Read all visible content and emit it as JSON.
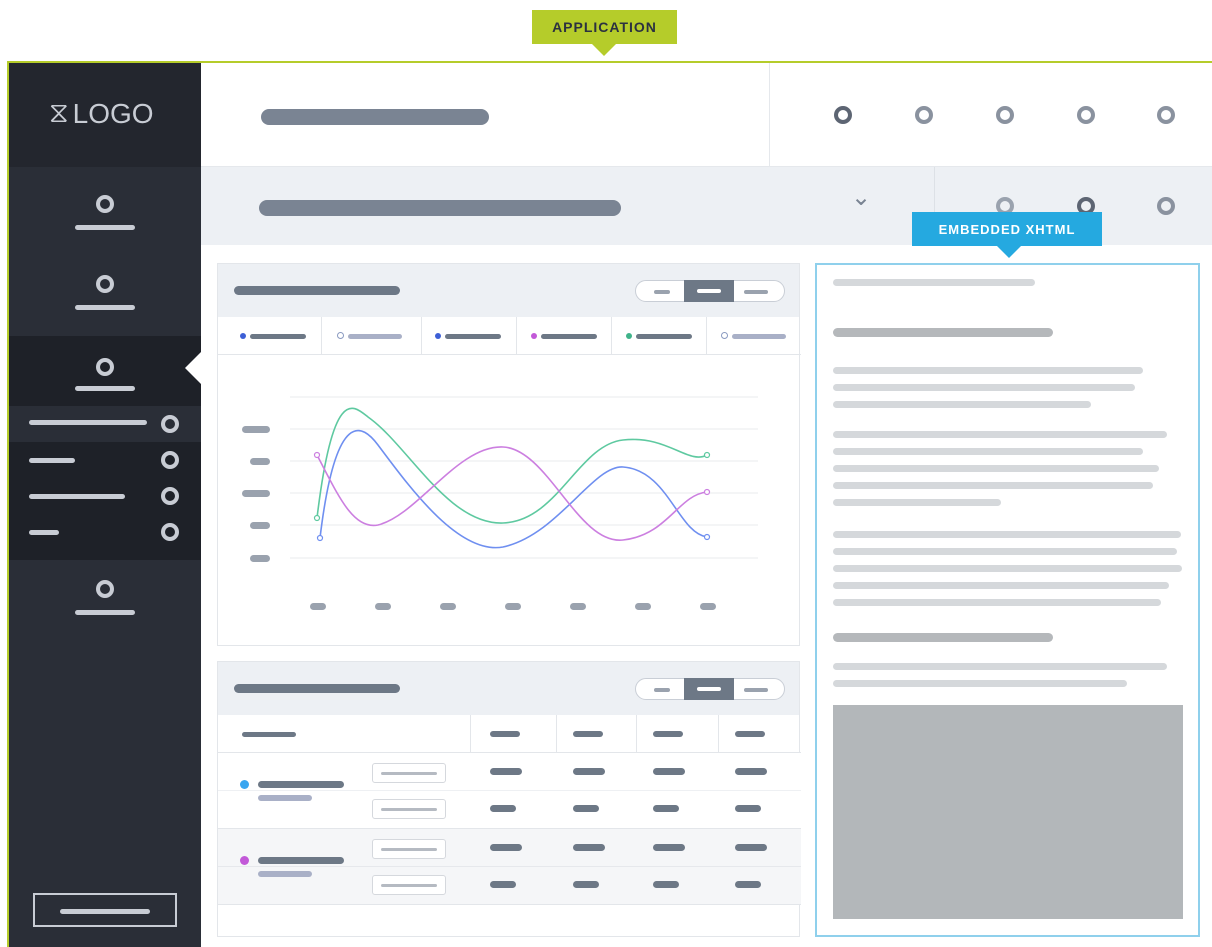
{
  "tags": {
    "application": "APPLICATION",
    "embedded": "EMBEDDED XHTML"
  },
  "sidebar": {
    "logo_text": "LOGO",
    "logo_mark": "⧖"
  },
  "colors": {
    "application_accent": "#b5cc2a",
    "embedded_accent": "#25a9e0",
    "sidebar_bg": "#2a2e37",
    "series_blue": "#6f8ff0",
    "series_green": "#5ec9a0",
    "series_purple": "#cc7fe0"
  },
  "icons": {
    "chevron": "chevron-down-icon",
    "logo": "logo-icon"
  },
  "chevron_glyph": "⌄"
}
